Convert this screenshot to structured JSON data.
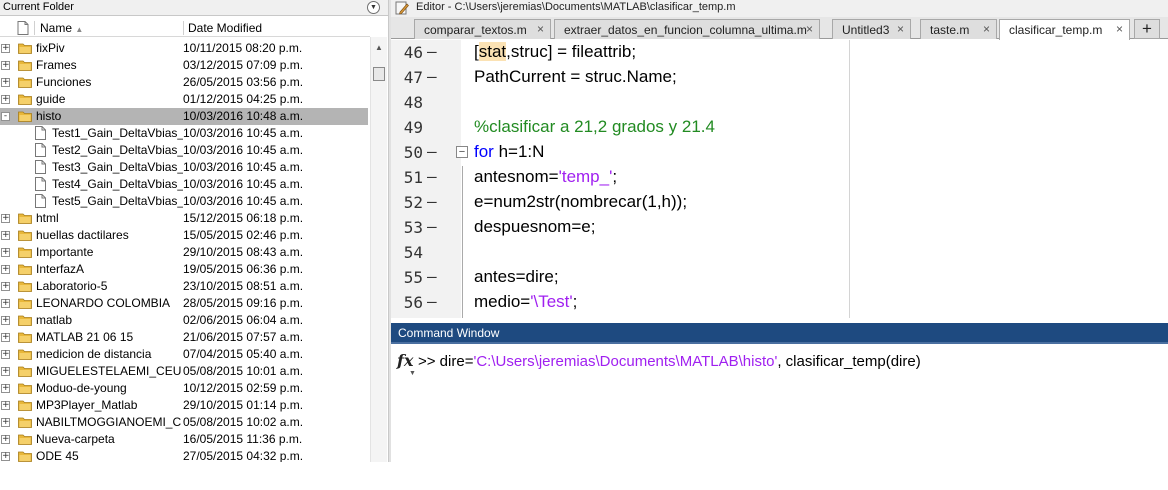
{
  "current_folder": {
    "title": "Current Folder",
    "menu_icon": "chevron-down-circle-icon",
    "columns": {
      "name": "Name",
      "name_sort_icon": "sort-ascending-icon",
      "date": "Date Modified"
    },
    "rows": [
      {
        "name": "fixPiv",
        "date": "10/11/2015 08:20 p.m.",
        "type": "folder",
        "level": 0,
        "expander": "+"
      },
      {
        "name": "Frames",
        "date": "03/12/2015 07:09 p.m.",
        "type": "folder",
        "level": 0,
        "expander": "+"
      },
      {
        "name": "Funciones",
        "date": "26/05/2015 03:56 p.m.",
        "type": "folder",
        "level": 0,
        "expander": "+"
      },
      {
        "name": "guide",
        "date": "01/12/2015 04:25 p.m.",
        "type": "folder",
        "level": 0,
        "expander": "+"
      },
      {
        "name": "histo",
        "date": "10/03/2016 10:48 a.m.",
        "type": "folder",
        "level": 0,
        "expander": "-",
        "selected": true
      },
      {
        "name": "Test1_Gain_DeltaVbias_...",
        "date": "10/03/2016 10:45 a.m.",
        "type": "file",
        "level": 1
      },
      {
        "name": "Test2_Gain_DeltaVbias_...",
        "date": "10/03/2016 10:45 a.m.",
        "type": "file",
        "level": 1
      },
      {
        "name": "Test3_Gain_DeltaVbias_...",
        "date": "10/03/2016 10:45 a.m.",
        "type": "file",
        "level": 1
      },
      {
        "name": "Test4_Gain_DeltaVbias_...",
        "date": "10/03/2016 10:45 a.m.",
        "type": "file",
        "level": 1
      },
      {
        "name": "Test5_Gain_DeltaVbias_...",
        "date": "10/03/2016 10:45 a.m.",
        "type": "file",
        "level": 1
      },
      {
        "name": "html",
        "date": "15/12/2015 06:18 p.m.",
        "type": "folder",
        "level": 0,
        "expander": "+"
      },
      {
        "name": "huellas dactilares",
        "date": "15/05/2015 02:46 p.m.",
        "type": "folder",
        "level": 0,
        "expander": "+"
      },
      {
        "name": "Importante",
        "date": "29/10/2015 08:43 a.m.",
        "type": "folder",
        "level": 0,
        "expander": "+"
      },
      {
        "name": "InterfazA",
        "date": "19/05/2015 06:36 p.m.",
        "type": "folder",
        "level": 0,
        "expander": "+"
      },
      {
        "name": "Laboratorio-5",
        "date": "23/10/2015 08:51 a.m.",
        "type": "folder",
        "level": 0,
        "expander": "+"
      },
      {
        "name": "LEONARDO COLOMBIA",
        "date": "28/05/2015 09:16 p.m.",
        "type": "folder",
        "level": 0,
        "expander": "+"
      },
      {
        "name": "matlab",
        "date": "02/06/2015 06:04 a.m.",
        "type": "folder",
        "level": 0,
        "expander": "+"
      },
      {
        "name": "MATLAB 21 06 15",
        "date": "21/06/2015 07:57 a.m.",
        "type": "folder",
        "level": 0,
        "expander": "+"
      },
      {
        "name": "medicion de distancia",
        "date": "07/04/2015 05:40 a.m.",
        "type": "folder",
        "level": 0,
        "expander": "+"
      },
      {
        "name": "MIGUELESTELAEMI_CEUP...",
        "date": "05/08/2015 10:01 a.m.",
        "type": "folder",
        "level": 0,
        "expander": "+"
      },
      {
        "name": "Moduo-de-young",
        "date": "10/12/2015 02:59 p.m.",
        "type": "folder",
        "level": 0,
        "expander": "+"
      },
      {
        "name": "MP3Player_Matlab",
        "date": "29/10/2015 01:14 p.m.",
        "type": "folder",
        "level": 0,
        "expander": "+"
      },
      {
        "name": "NABILTMOGGIANOEMI_C...",
        "date": "05/08/2015 10:02 a.m.",
        "type": "folder",
        "level": 0,
        "expander": "+"
      },
      {
        "name": "Nueva-carpeta",
        "date": "16/05/2015 11:36 p.m.",
        "type": "folder",
        "level": 0,
        "expander": "+"
      },
      {
        "name": "ODE 45",
        "date": "27/05/2015 04:32 p.m.",
        "type": "folder",
        "level": 0,
        "expander": "+"
      }
    ]
  },
  "editor": {
    "title": "Editor - C:\\Users\\jeremias\\Documents\\MATLAB\\clasificar_temp.m",
    "tabs": [
      {
        "label": "comparar_textos.m",
        "close": "×"
      },
      {
        "label": "extraer_datos_en_funcion_columna_ultima.m",
        "close": "×"
      },
      {
        "label": "Untitled3",
        "close": "×"
      },
      {
        "label": "taste.m",
        "close": "×"
      },
      {
        "label": "clasificar_temp.m",
        "close": "×",
        "active": true
      }
    ],
    "add_tab": "+",
    "lines": [
      {
        "num": "46",
        "dash": "–",
        "segments": [
          {
            "t": "[",
            "c": "plain"
          },
          {
            "t": "stat",
            "c": "hl"
          },
          {
            "t": ",struc] = fileattrib;",
            "c": "plain"
          }
        ]
      },
      {
        "num": "47",
        "dash": "–",
        "segments": [
          {
            "t": "PathCurrent = struc.Name;",
            "c": "plain"
          }
        ]
      },
      {
        "num": "48",
        "dash": "",
        "segments": []
      },
      {
        "num": "49",
        "dash": "",
        "segments": [
          {
            "t": "%clasificar a 21,2 grados y 21.4",
            "c": "cmt"
          }
        ]
      },
      {
        "num": "50",
        "dash": "–",
        "fold": "−",
        "segments": [
          {
            "t": "for",
            "c": "kw"
          },
          {
            "t": " h=1:N",
            "c": "plain"
          }
        ]
      },
      {
        "num": "51",
        "dash": "–",
        "segments": [
          {
            "t": "antesnom=",
            "c": "plain"
          },
          {
            "t": "'temp_'",
            "c": "str"
          },
          {
            "t": ";",
            "c": "plain"
          }
        ]
      },
      {
        "num": "52",
        "dash": "–",
        "segments": [
          {
            "t": "e=num2str(nombrecar(1,h));",
            "c": "plain"
          }
        ]
      },
      {
        "num": "53",
        "dash": "–",
        "segments": [
          {
            "t": "despuesnom=e;",
            "c": "plain"
          }
        ]
      },
      {
        "num": "54",
        "dash": "",
        "segments": []
      },
      {
        "num": "55",
        "dash": "–",
        "segments": [
          {
            "t": "antes=dire;",
            "c": "plain"
          }
        ]
      },
      {
        "num": "56",
        "dash": "–",
        "segments": [
          {
            "t": "medio=",
            "c": "plain"
          },
          {
            "t": "'\\Test'",
            "c": "str"
          },
          {
            "t": ";",
            "c": "plain"
          }
        ]
      }
    ]
  },
  "command_window": {
    "title": "Command Window",
    "fx_icon": "fx",
    "segments": [
      {
        "t": ">> dire=",
        "c": "plain"
      },
      {
        "t": "'C:\\Users\\jeremias\\Documents\\MATLAB\\histo'",
        "c": "str"
      },
      {
        "t": ", clasificar_temp(dire)",
        "c": "plain"
      }
    ]
  },
  "colors": {
    "keyword": "#0000ff",
    "string": "#a020f0",
    "comment": "#228b22",
    "selection_row": "#b4b4b4",
    "command_titlebar": "#1e4a80",
    "folder_icon": "#e8b73a"
  }
}
